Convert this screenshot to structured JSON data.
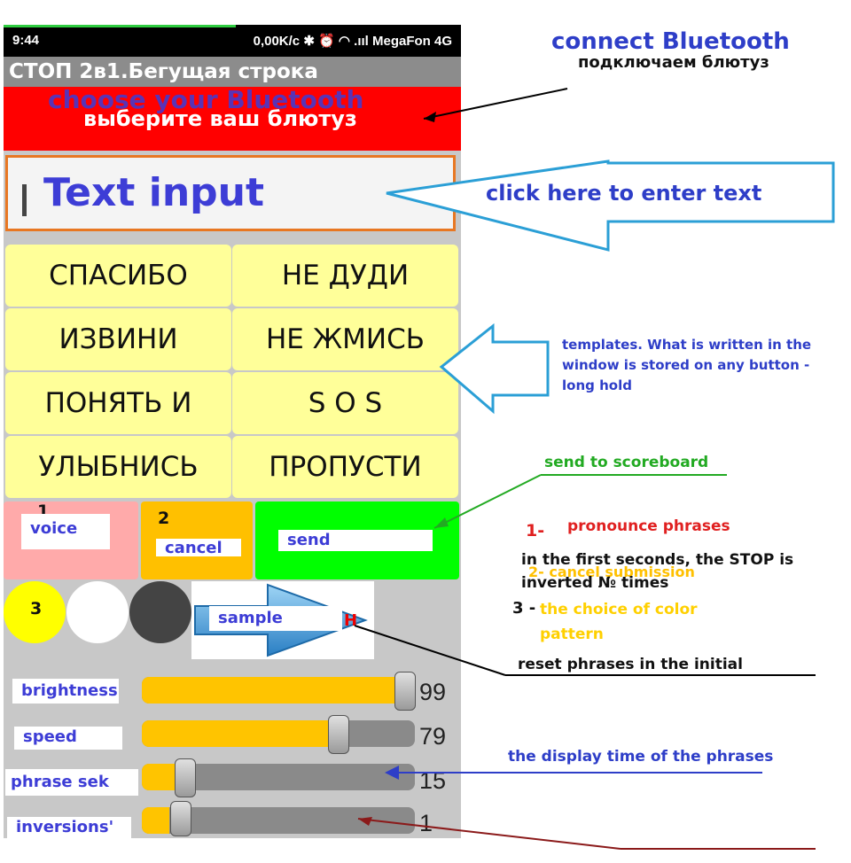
{
  "status_bar": {
    "time": "9:44",
    "right": "0,00K/c ✱ ⏰ ◠ .ııl MegaFon 4G"
  },
  "title": "СТОП 2в1.Бегущая строка",
  "bluetooth_bar": {
    "en": "choose your Bluetooth",
    "ru": "выберите ваш блютуз"
  },
  "text_input": {
    "value": "Text input"
  },
  "templates": [
    {
      "label": "СПАСИБО"
    },
    {
      "label": "НЕ ДУДИ"
    },
    {
      "label": "ИЗВИНИ"
    },
    {
      "label": "НЕ ЖМИСЬ"
    },
    {
      "label": "ПОНЯТЬ И"
    },
    {
      "label": "S O S"
    },
    {
      "label": "УЛЫБНИСЬ"
    },
    {
      "label": "ПРОПУСТИ"
    }
  ],
  "actions": {
    "voice": {
      "num": "1",
      "label": "voice",
      "color": "#ffaaaa"
    },
    "cancel": {
      "num": "2",
      "label": "cancel",
      "color": "#ffc000"
    },
    "send": {
      "label": "send",
      "color": "#00ff00"
    }
  },
  "colors": {
    "num": "3",
    "swatches": [
      "#ffff00",
      "#ffffff",
      "#444444"
    ],
    "sample_label": "sample"
  },
  "sliders": [
    {
      "label": "brightness",
      "value": "99",
      "fraction": 0.99
    },
    {
      "label": "speed",
      "value": "79",
      "fraction": 0.79
    },
    {
      "label": "phrase sek",
      "value": "15",
      "fraction": 0.15
    },
    {
      "label": "inversions'",
      "value": "1",
      "fraction": 0.01
    }
  ],
  "annotations": {
    "connect_en": "connect Bluetooth",
    "connect_ru": "подключаем блютуз",
    "click_here": "click here to enter text",
    "templates_note_1": "templates. What is written in the",
    "templates_note_2": "window is stored on any button -",
    "templates_note_3": "long hold",
    "send_to_scoreboard": "send to scoreboard",
    "legend_1_num": "1-",
    "legend_1_text": "pronounce phrases",
    "legend_1b": "in the first seconds, the STOP is",
    "legend_1c": "inverted № times",
    "legend_2": "2- cancel submission",
    "legend_3_num": "3 -",
    "legend_3_text": "the choice of color",
    "legend_3b": "pattern",
    "reset_note": "reset phrases in the initial",
    "display_time": "the display time of the phrases"
  }
}
